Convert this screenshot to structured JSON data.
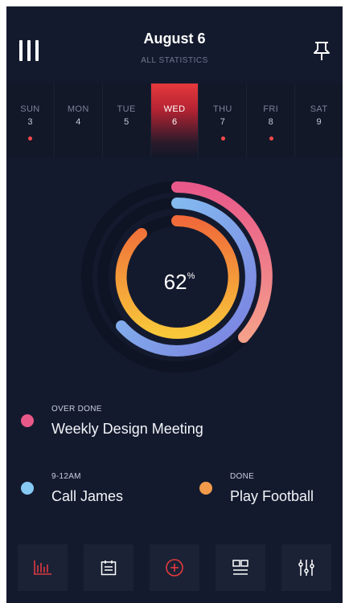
{
  "header": {
    "title": "August 6",
    "subtitle": "ALL STATISTICS",
    "menu_icon": "menu-icon",
    "pin_icon": "pin-icon"
  },
  "days": [
    {
      "name": "SUN",
      "num": "3",
      "dot": true,
      "active": false
    },
    {
      "name": "MON",
      "num": "4",
      "dot": false,
      "active": false
    },
    {
      "name": "TUE",
      "num": "5",
      "dot": false,
      "active": false
    },
    {
      "name": "WED",
      "num": "6",
      "dot": false,
      "active": true
    },
    {
      "name": "THU",
      "num": "7",
      "dot": true,
      "active": false
    },
    {
      "name": "FRI",
      "num": "8",
      "dot": true,
      "active": false
    },
    {
      "name": "SAT",
      "num": "9",
      "dot": false,
      "active": false
    }
  ],
  "progress": {
    "value": "62",
    "unit": "%"
  },
  "tasks": {
    "weekly": {
      "meta": "OVER DONE",
      "name": "Weekly Design Meeting",
      "color": "#e8598a"
    },
    "call": {
      "meta": "9-12AM",
      "name": "Call James",
      "color": "#86c9f3"
    },
    "football": {
      "meta": "DONE",
      "name": "Play Football",
      "color": "#f39a4b"
    }
  },
  "tabbar": [
    "stats-icon",
    "calendar-icon",
    "add-icon",
    "list-icon",
    "sliders-icon"
  ],
  "colors": {
    "background": "#141a2e",
    "accent_red": "#e63a3d",
    "pink": "#e8598a",
    "blue": "#86c9f3",
    "orange": "#f39a4b"
  }
}
